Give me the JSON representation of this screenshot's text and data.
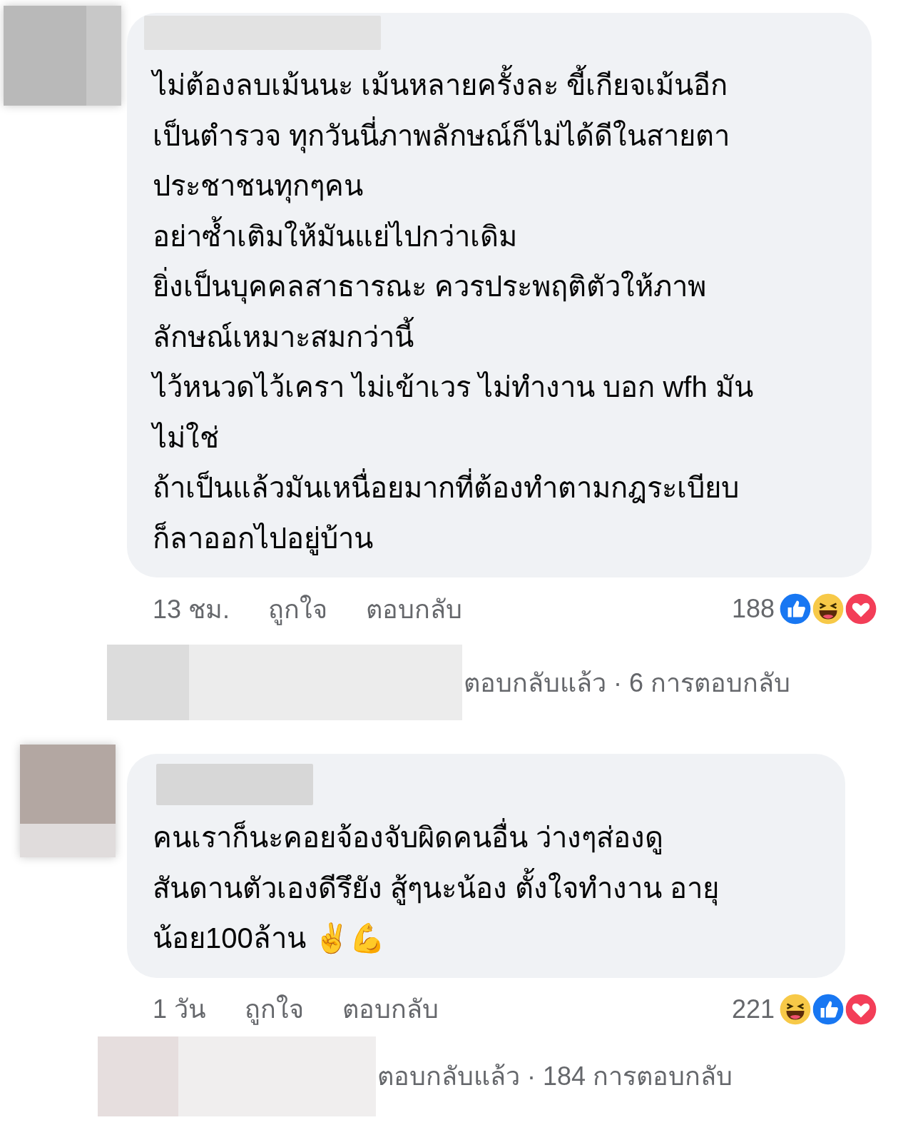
{
  "comments": [
    {
      "text": "ไม่ต้องลบเม้นนะ เม้นหลายครั้งละ ขี้เกียจเม้นอีก\nเป็นตำรวจ ทุกวันนี่ภาพลักษณ์ก็ไม่ได้ดีในสายตา\nประชาชนทุกๆคน\nอย่าซ้ำเติมให้มันแย่ไปกว่าเดิม\nยิ่งเป็นบุคคลสาธารณะ ควรประพฤติตัวให้ภาพ\nลักษณ์เหมาะสมกว่านี้\nไว้หนวดไว้เครา ไม่เข้าเวร ไม่ทำงาน บอก wfh มัน\nไม่ใช่\nถ้าเป็นแล้วมันเหนื่อยมากที่ต้องทำตามกฎระเบียบ\nก็ลาออกไปอยู่บ้าน",
      "time": "13 ชม.",
      "like": "ถูกใจ",
      "reply": "ตอบกลับ",
      "count": "188",
      "reactions": [
        {
          "kind": "like"
        },
        {
          "kind": "haha"
        },
        {
          "kind": "love"
        }
      ],
      "replies": {
        "label": "ตอบกลับแล้ว",
        "separator": "·",
        "count": "6 การตอบกลับ"
      }
    },
    {
      "text": "คนเราก็นะคอยจ้องจับผิดคนอื่น ว่างๆส่องดู\nสันดานตัวเองดีรึยัง สู้ๆนะน้อง ตั้งใจทำงาน อายุ\nน้อย100ล้าน ✌️💪",
      "time": "1 วัน",
      "like": "ถูกใจ",
      "reply": "ตอบกลับ",
      "count": "221",
      "reactions": [
        {
          "kind": "haha"
        },
        {
          "kind": "like"
        },
        {
          "kind": "love"
        }
      ],
      "replies": {
        "label": "ตอบกลับแล้ว",
        "separator": "·",
        "count": "184 การตอบกลับ"
      }
    }
  ]
}
